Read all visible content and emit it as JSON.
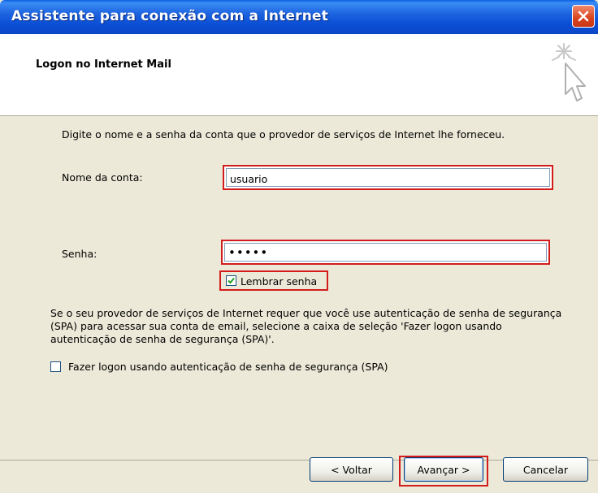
{
  "window": {
    "title": "Assistente para conexão com a Internet"
  },
  "header": {
    "title": "Logon no Internet Mail"
  },
  "form": {
    "instruction": "Digite o nome e a senha da conta que o provedor de serviços de Internet lhe forneceu.",
    "account_label": "Nome da conta:",
    "account_value": "usuario",
    "password_label": "Senha:",
    "password_value": "•••••",
    "remember_label": "Lembrar senha",
    "remember_checked": true,
    "spa_description": "Se o seu provedor de serviços de Internet requer que você use autenticação de senha de segurança (SPA) para acessar sua conta de email, selecione a caixa de seleção 'Fazer logon usando autenticação de senha de segurança (SPA)'.",
    "spa_label": "Fazer logon usando autenticação de senha de segurança (SPA)",
    "spa_checked": false
  },
  "buttons": {
    "back": "< Voltar",
    "next": "Avançar >",
    "cancel": "Cancelar"
  },
  "colors": {
    "titlebar": "#0b4fd6",
    "highlight": "#d21c1c",
    "dialog_bg": "#ece9d8",
    "checkmark": "#21a121"
  }
}
